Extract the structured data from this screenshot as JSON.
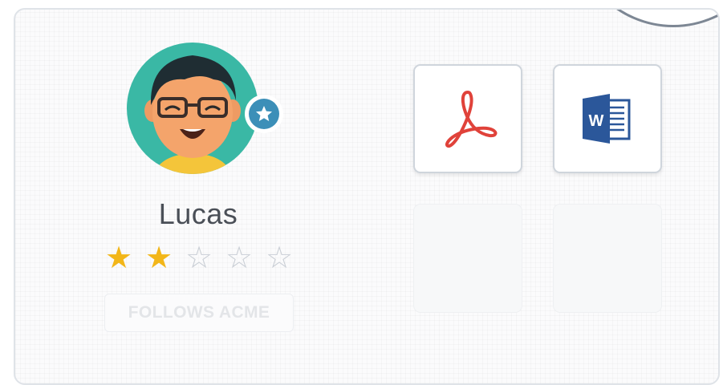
{
  "profile": {
    "name": "Lucas",
    "rating": {
      "value": 2,
      "max": 5
    },
    "badge_icon": "star-icon",
    "follow_label": "FOLLOWS ACME"
  },
  "files": [
    {
      "icon": "pdf-icon",
      "type": "PDF"
    },
    {
      "icon": "word-icon",
      "type": "Word",
      "letter": "W"
    }
  ],
  "colors": {
    "star_filled": "#f2b619",
    "star_empty": "#c9ced5",
    "badge": "#3c8fb8",
    "pdf_red": "#e0423a",
    "word_blue": "#2b579a",
    "avatar_bg": "#3ab8a5"
  }
}
